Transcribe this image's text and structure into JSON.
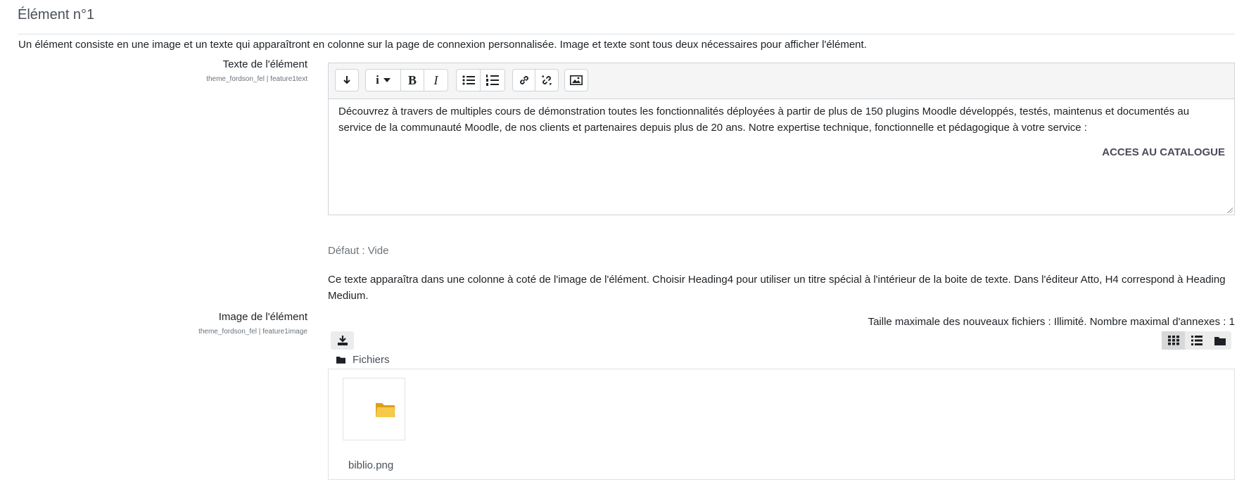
{
  "section": {
    "title": "Élément n°1",
    "description": "Un élément consiste en une image et un texte qui apparaîtront en colonne sur la page de connexion personnalisée. Image et texte sont tous deux nécessaires pour afficher l'élément."
  },
  "text_field": {
    "label": "Texte de l'élément",
    "key": "theme_fordson_fel | feature1text",
    "content": "Découvrez à travers de multiples cours de démonstration toutes les fonctionnalités déployées à partir de plus de 150 plugins Moodle développés, testés, maintenus et documentés au service de la communauté Moodle, de nos clients et partenaires depuis plus de 20 ans.  Notre expertise technique,  fonctionnelle et pédagogique à votre service :",
    "cta": "ACCES AU CATALOGUE",
    "default": "Défaut : Vide",
    "help": "Ce texte apparaîtra dans une colonne à coté de l'image de l'élément. Choisir Heading4 pour utiliser un titre spécial à l'intérieur de la boite de texte. Dans l'éditeur Atto, H4 correspond à Heading Medium."
  },
  "toolbar": {
    "buttons": [
      "collapse-icon",
      "paragraph-style-icon",
      "bold-icon",
      "italic-icon",
      "unordered-list-icon",
      "ordered-list-icon",
      "link-icon",
      "unlink-icon",
      "image-icon"
    ],
    "bold_glyph": "B",
    "italic_glyph": "I",
    "info_glyph": "i"
  },
  "image_field": {
    "label": "Image de l'élément",
    "key": "theme_fordson_fel | feature1image",
    "max_info": "Taille maximale des nouveaux fichiers : Illimité. Nombre maximal d'annexes : 1",
    "path_label": "Fichiers",
    "file_name": "biblio.png",
    "view_modes": [
      "grid-view-icon",
      "list-view-icon",
      "tree-view-icon"
    ],
    "active_view": "grid-view-icon"
  }
}
